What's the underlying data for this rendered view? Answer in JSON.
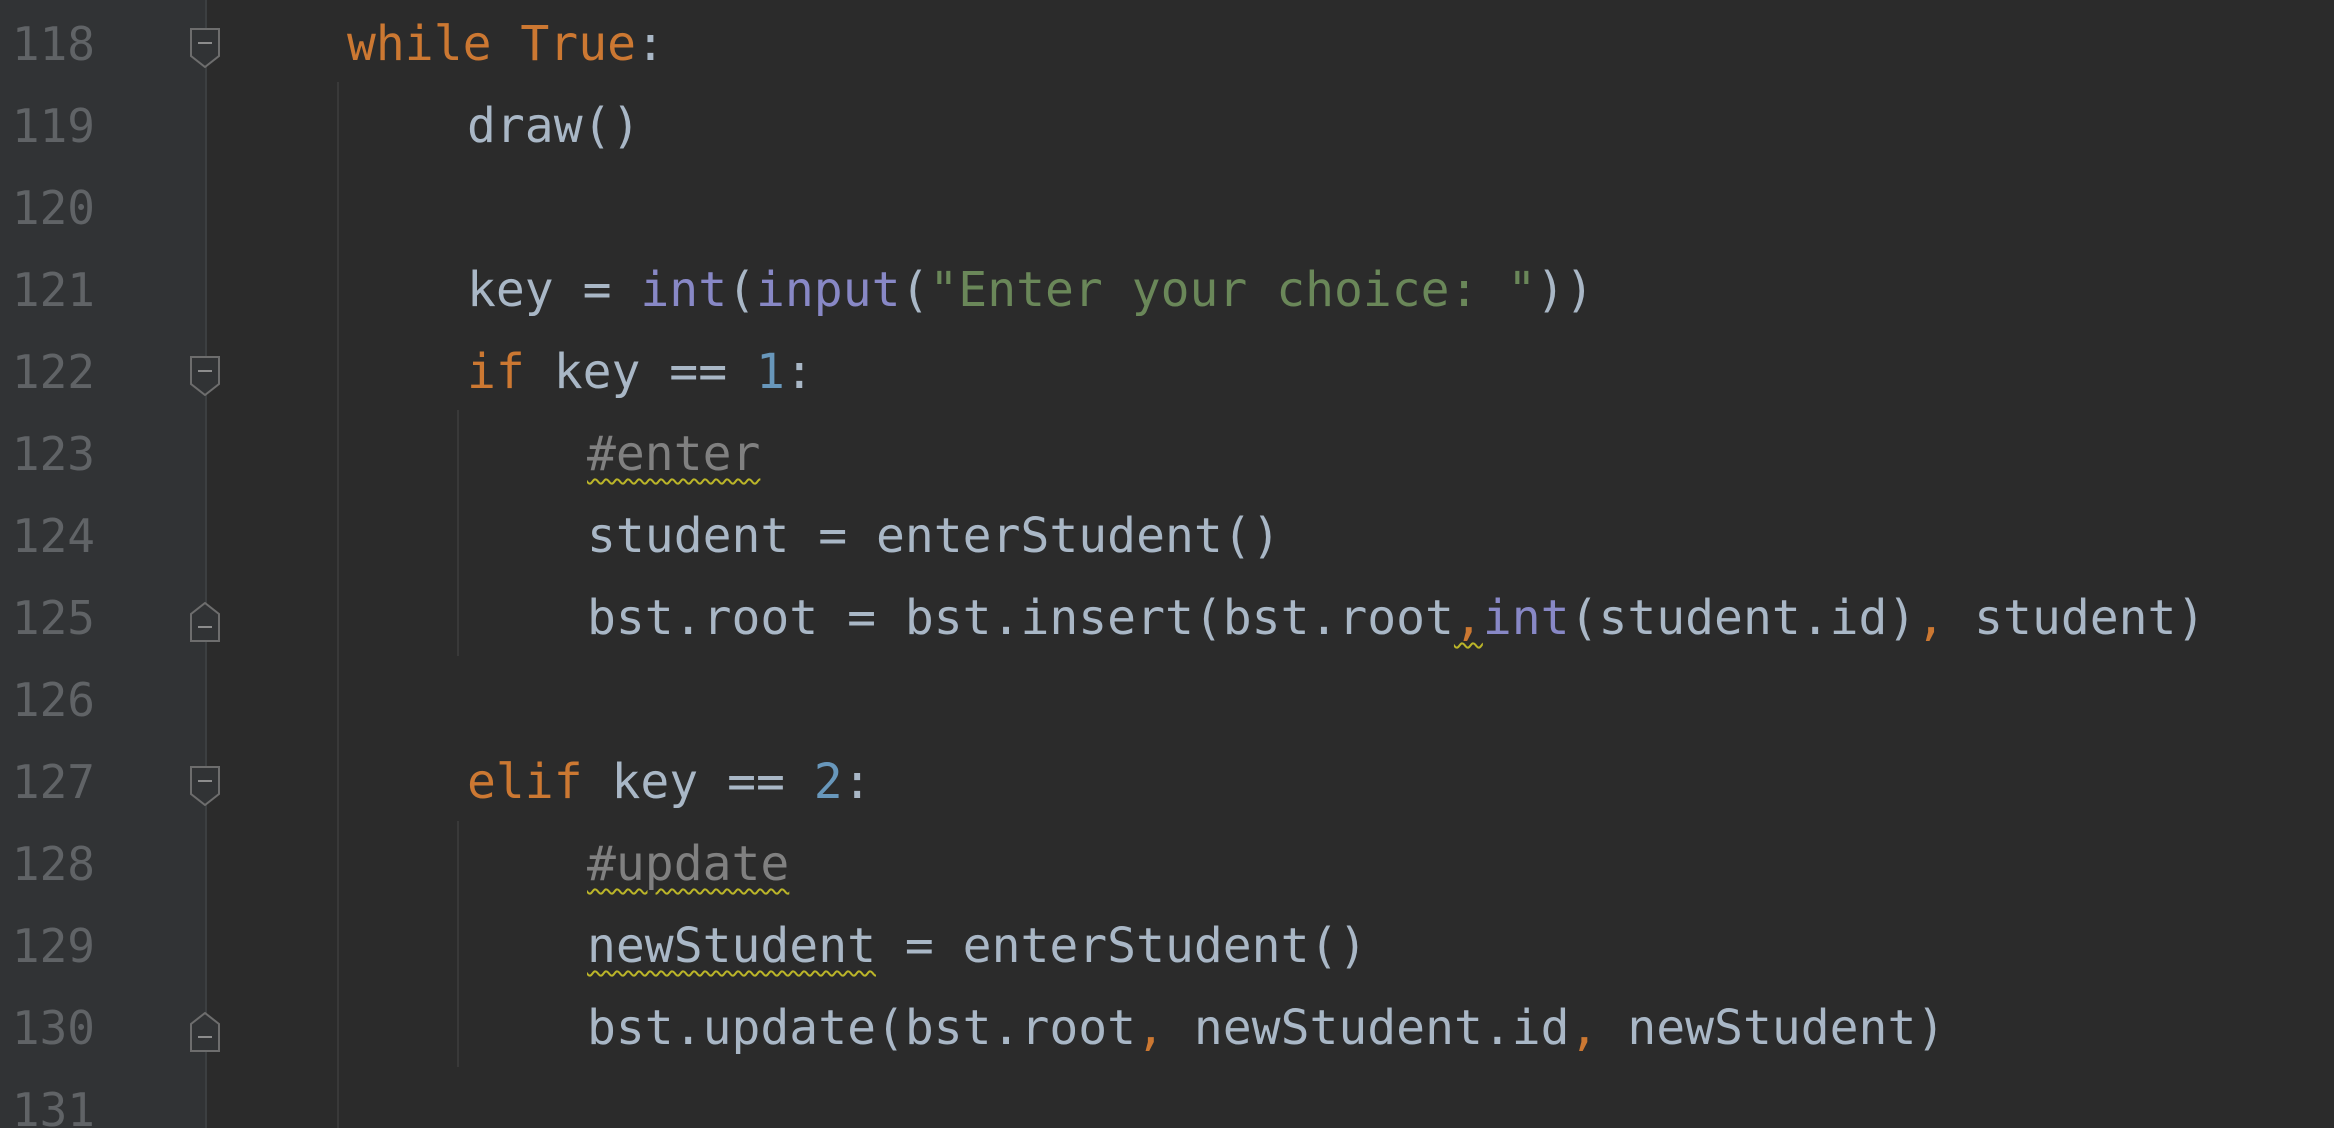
{
  "editor": {
    "lines": [
      {
        "num": "118",
        "tokens": [
          {
            "t": "while",
            "c": "kw"
          },
          {
            "t": " ",
            "c": ""
          },
          {
            "t": "True",
            "c": "kw"
          },
          {
            "t": ":",
            "c": ""
          }
        ]
      },
      {
        "num": "119",
        "tokens": [
          {
            "t": "draw()",
            "c": ""
          }
        ]
      },
      {
        "num": "120",
        "tokens": []
      },
      {
        "num": "121",
        "tokens": [
          {
            "t": "key = ",
            "c": ""
          },
          {
            "t": "int",
            "c": "fn"
          },
          {
            "t": "(",
            "c": ""
          },
          {
            "t": "input",
            "c": "fn"
          },
          {
            "t": "(",
            "c": ""
          },
          {
            "t": "\"Enter your choice: \"",
            "c": "str"
          },
          {
            "t": "))",
            "c": ""
          }
        ]
      },
      {
        "num": "122",
        "tokens": [
          {
            "t": "if",
            "c": "kw"
          },
          {
            "t": " key == ",
            "c": ""
          },
          {
            "t": "1",
            "c": "num"
          },
          {
            "t": ":",
            "c": ""
          }
        ]
      },
      {
        "num": "123",
        "tokens": [
          {
            "t": "#enter",
            "c": "cmt squiggle"
          }
        ]
      },
      {
        "num": "124",
        "tokens": [
          {
            "t": "student = enterStudent()",
            "c": ""
          }
        ]
      },
      {
        "num": "125",
        "tokens": [
          {
            "t": "bst.root = bst.insert(bst.root",
            "c": ""
          },
          {
            "t": ",",
            "c": "comma squiggle"
          },
          {
            "t": "int",
            "c": "fn"
          },
          {
            "t": "(student.id)",
            "c": ""
          },
          {
            "t": ",",
            "c": "comma"
          },
          {
            "t": " student)",
            "c": ""
          }
        ]
      },
      {
        "num": "126",
        "tokens": []
      },
      {
        "num": "127",
        "tokens": [
          {
            "t": "elif",
            "c": "kw"
          },
          {
            "t": " key == ",
            "c": ""
          },
          {
            "t": "2",
            "c": "num"
          },
          {
            "t": ":",
            "c": ""
          }
        ]
      },
      {
        "num": "128",
        "tokens": [
          {
            "t": "#update",
            "c": "cmt squiggle"
          }
        ]
      },
      {
        "num": "129",
        "tokens": [
          {
            "t": "newStudent",
            "c": "squiggle"
          },
          {
            "t": " = enterStudent()",
            "c": ""
          }
        ]
      },
      {
        "num": "130",
        "tokens": [
          {
            "t": "bst.update(bst.root",
            "c": ""
          },
          {
            "t": ",",
            "c": "comma"
          },
          {
            "t": " newStudent.id",
            "c": ""
          },
          {
            "t": ",",
            "c": "comma"
          },
          {
            "t": " newStudent)",
            "c": ""
          }
        ]
      },
      {
        "num": "131",
        "tokens": []
      }
    ],
    "colors": {
      "background": "#2b2b2b",
      "gutter": "#313335",
      "keyword": "#cc7832",
      "builtin": "#8888c6",
      "string": "#6a8759",
      "number": "#6897bb",
      "comment": "#808080",
      "text": "#a9b7c6",
      "line_number": "#606366"
    },
    "fold_markers": [
      {
        "line": "118",
        "icon": "fold-open-icon"
      },
      {
        "line": "122",
        "icon": "fold-open-icon"
      },
      {
        "line": "125",
        "icon": "fold-close-icon"
      },
      {
        "line": "127",
        "icon": "fold-open-icon"
      },
      {
        "line": "130",
        "icon": "fold-close-icon"
      }
    ]
  }
}
